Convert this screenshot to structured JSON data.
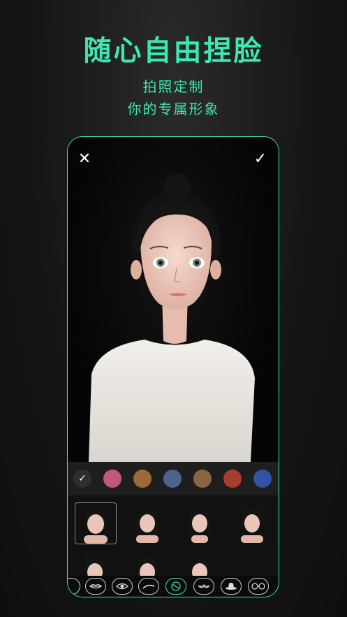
{
  "headline": "随心自由捏脸",
  "subtitle_line1": "拍照定制",
  "subtitle_line2": "你的专属形象",
  "editor": {
    "close_icon": "close-icon",
    "confirm_icon": "check-icon"
  },
  "palette": {
    "colors": [
      "#2e2e2e",
      "#c2577a",
      "#9c6a35",
      "#4e638c",
      "#8b6540",
      "#a93d2b",
      "#3253a0",
      "#d4e07a"
    ],
    "selected_index": 0
  },
  "hair_grid": {
    "styles": [
      "bun-hair",
      "bangs-long",
      "braids",
      "twin-buns",
      "short-bob",
      "bangs-short",
      "ponytail"
    ],
    "selected_index": 0
  },
  "category_tabs": [
    "partial-tab",
    "lips-icon",
    "eye-icon",
    "eyebrow-icon",
    "hair-icon",
    "mustache-icon",
    "hat-icon",
    "glasses-icon"
  ],
  "active_tab": "hair-icon",
  "colors": {
    "accent": "#3ee6b3"
  }
}
